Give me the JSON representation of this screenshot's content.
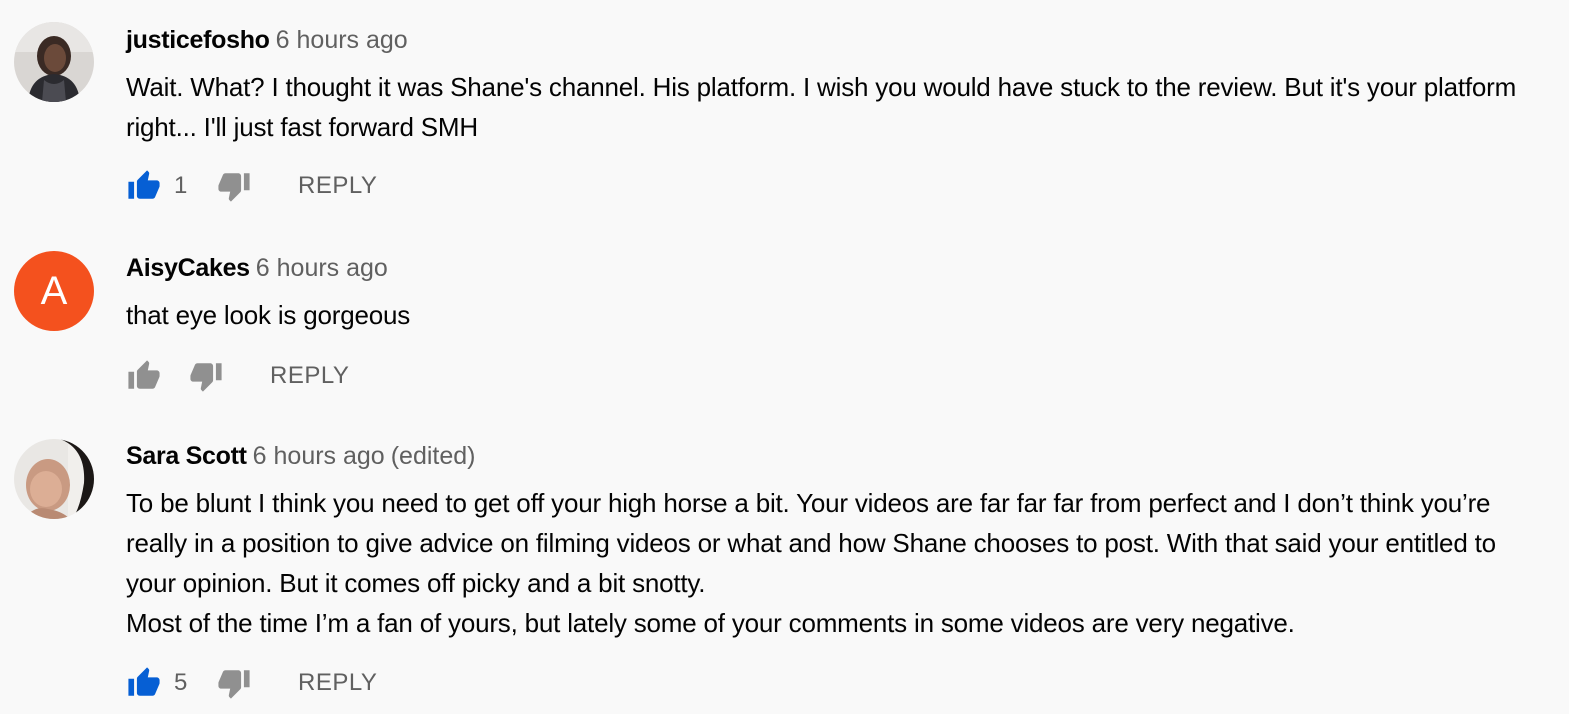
{
  "comments": [
    {
      "author": "justicefosho",
      "time": "6 hours ago",
      "body_lines": [
        "Wait. What? I thought it was Shane's channel. His platform. I wish you would have stuck to the review. But it's your platform right... I'll just fast forward SMH"
      ],
      "likes": "1",
      "liked": true,
      "reply_label": "REPLY",
      "avatar_type": "photo"
    },
    {
      "author": "AisyCakes",
      "time": "6 hours ago",
      "body_lines": [
        "that eye look is gorgeous"
      ],
      "likes": "",
      "liked": false,
      "reply_label": "REPLY",
      "avatar_type": "letter",
      "avatar_letter": "A",
      "avatar_color": "#f4511e"
    },
    {
      "author": "Sara Scott",
      "time": "6 hours ago",
      "edited": "(edited)",
      "body_lines": [
        "To be blunt I think you need to get off your high horse a bit. Your videos are far far far from perfect and I don’t think you’re really in a position to give advice on filming videos or what and how Shane chooses to post. With that said your entitled to your opinion. But it comes off picky and a bit snotty.",
        "Most of the time I’m a fan of yours, but lately some of your comments in some videos are very negative."
      ],
      "likes": "5",
      "liked": true,
      "reply_label": "REPLY",
      "avatar_type": "photo"
    }
  ],
  "colors": {
    "liked_blue": "#065fd4",
    "icon_gray": "#909090",
    "text_secondary": "#606060",
    "background": "#f9f9f9"
  }
}
